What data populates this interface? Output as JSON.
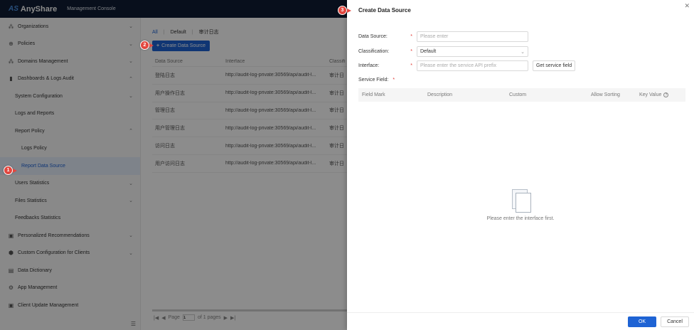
{
  "app": {
    "brand": "AnyShare",
    "console_title": "Management Console"
  },
  "sidebar": {
    "items": [
      {
        "label": "Organizations",
        "icon": "org-icon",
        "chev": "⌄",
        "level": 0
      },
      {
        "label": "Policies",
        "icon": "policy-icon",
        "chev": "⌄",
        "level": 0
      },
      {
        "label": "Domains Management",
        "icon": "domain-icon",
        "chev": "⌄",
        "level": 0
      },
      {
        "label": "Dashboards & Logs Audit",
        "icon": "dashboard-icon",
        "chev": "⌃",
        "level": 0
      },
      {
        "label": "System Configuration",
        "chev": "⌄",
        "level": 1
      },
      {
        "label": "Logs and Reports",
        "chev": "",
        "level": 1
      },
      {
        "label": "Report Policy",
        "chev": "⌃",
        "level": 1
      },
      {
        "label": "Logs Policy",
        "chev": "",
        "level": 2
      },
      {
        "label": "Report Data Source",
        "chev": "",
        "level": 2,
        "active": true
      },
      {
        "label": "Users Statistics",
        "chev": "⌄",
        "level": 1
      },
      {
        "label": "Files Statistics",
        "chev": "⌄",
        "level": 1
      },
      {
        "label": "Feedbacks Statistics",
        "chev": "",
        "level": 1
      },
      {
        "label": "Personalized Recommendations",
        "icon": "recommend-icon",
        "chev": "⌄",
        "level": 0
      },
      {
        "label": "Custom Configuration for Clients",
        "icon": "custom-icon",
        "chev": "⌄",
        "level": 0
      },
      {
        "label": "Data Dictionary",
        "icon": "dictionary-icon",
        "chev": "",
        "level": 0
      },
      {
        "label": "App Management",
        "icon": "app-icon",
        "chev": "",
        "level": 0
      },
      {
        "label": "Client Update Management",
        "icon": "update-icon",
        "chev": "",
        "level": 0
      }
    ]
  },
  "main": {
    "tabs": [
      "All",
      "Default",
      "审计日志"
    ],
    "create_button": "Create Data Source",
    "table": {
      "headers": [
        "Data Source",
        "Interface",
        "Classifi"
      ],
      "rows": [
        [
          "登陆日志",
          "http://audit-log-private:30569/api/audit-l...",
          "审计日"
        ],
        [
          "用户操作日志",
          "http://audit-log-private:30569/api/audit-l...",
          "审计日"
        ],
        [
          "管理日志",
          "http://audit-log-private:30569/api/audit-l...",
          "审计日"
        ],
        [
          "用户管理日志",
          "http://audit-log-private:30569/api/audit-l...",
          "审计日"
        ],
        [
          "访问日志",
          "http://audit-log-private:30569/api/audit-l...",
          "审计日"
        ],
        [
          "用户访问日志",
          "http://audit-log-private:30569/api/audit-l...",
          "审计日"
        ]
      ]
    },
    "pager": {
      "page_label": "Page",
      "page_value": "1",
      "of_label": "of 1 pages"
    }
  },
  "drawer": {
    "title": "Create Data Source",
    "data_source_label": "Data Source:",
    "data_source_placeholder": "Please enter",
    "classification_label": "Classification:",
    "classification_value": "Default",
    "interface_label": "Interface:",
    "interface_placeholder": "Please enter the service API prefix",
    "get_field_button": "Get service field",
    "service_field_label": "Service Field:",
    "required_mark": "*",
    "field_headers": [
      "Field Mark",
      "Description",
      "Custom",
      "Allow Sorting",
      "Key Value"
    ],
    "empty_text": "Please enter the interface first.",
    "ok_label": "OK",
    "cancel_label": "Cancel"
  },
  "badges": [
    "1",
    "2",
    "3"
  ],
  "colors": {
    "accent": "#1e63d4",
    "badge": "#e2473f",
    "topbar": "#101c33"
  }
}
